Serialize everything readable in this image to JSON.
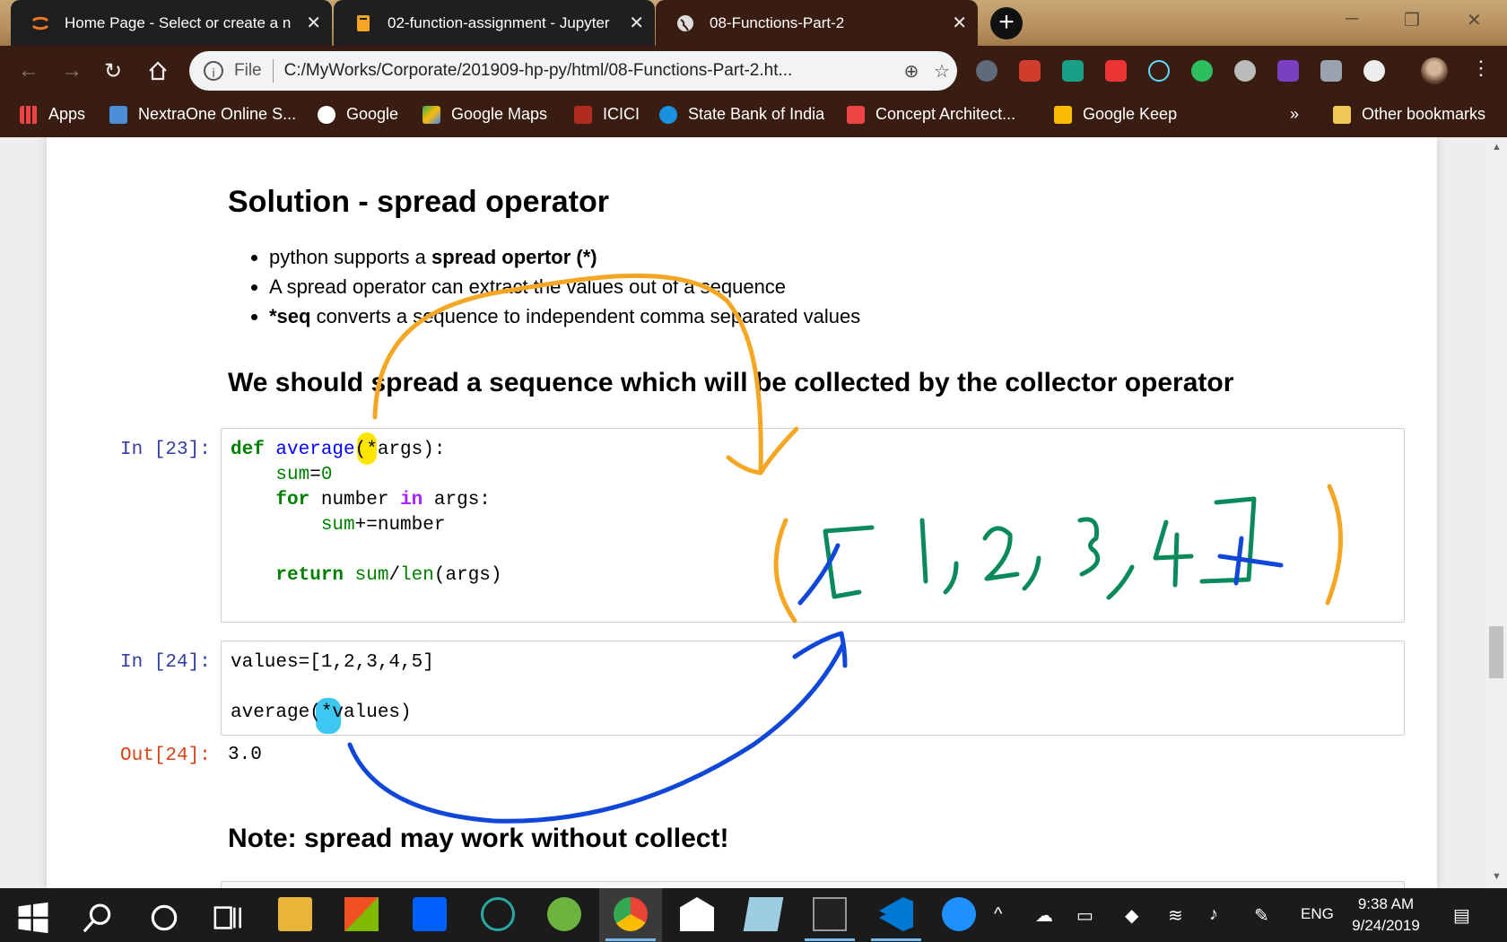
{
  "browser": {
    "tabs": [
      {
        "title": "Home Page - Select or create a n",
        "close": "✕"
      },
      {
        "title": "02-function-assignment - Jupyter",
        "close": "✕"
      },
      {
        "title": "08-Functions-Part-2",
        "close": "✕"
      }
    ],
    "new_tab": "+",
    "address": {
      "scheme_label": "File",
      "url": "C:/MyWorks/Corporate/201909-hp-py/html/08-Functions-Part-2.ht..."
    },
    "bookmarks": [
      "Apps",
      "NextraOne Online S...",
      "Google",
      "Google Maps",
      "ICICI",
      "State Bank of India",
      "Concept Architect...",
      "Google Keep"
    ],
    "bookmarks_overflow": "»",
    "other_bookmarks": "Other bookmarks"
  },
  "notebook": {
    "heading_solution": "Solution - spread operator",
    "bullets": [
      {
        "pre": "python supports a ",
        "bold": "spread opertor (*)",
        "post": ""
      },
      {
        "pre": "A spread operator can extract the values out of a sequence",
        "bold": "",
        "post": ""
      },
      {
        "pre": "",
        "bold": "*seq",
        "post": " converts a sequence to independent comma separated values"
      }
    ],
    "heading_spread": "We should spread a sequence which will be collected by the collector operator",
    "cell1_prompt": "In [23]:",
    "cell2_prompt": "In [24]:",
    "cell2_line1": "values=[1,2,3,4,5]",
    "cell2_line2": "average(*values)",
    "out_prompt": "Out[24]:",
    "output_value": "3.0",
    "heading_note": "Note: spread may work without collect!",
    "annotation_text": "( [ 1, 2, 3, 4 ] )"
  },
  "taskbar": {
    "time": "9:38 AM",
    "date": "9/24/2019",
    "language": "ENG"
  },
  "colors": {
    "chrome_frame": "#3a1d12",
    "annotation_orange": "#f5a623",
    "annotation_green": "#0a8a5a",
    "annotation_blue": "#1047d8",
    "highlight_yellow": "#ffe600",
    "highlight_cyan": "#3cc8f0"
  }
}
